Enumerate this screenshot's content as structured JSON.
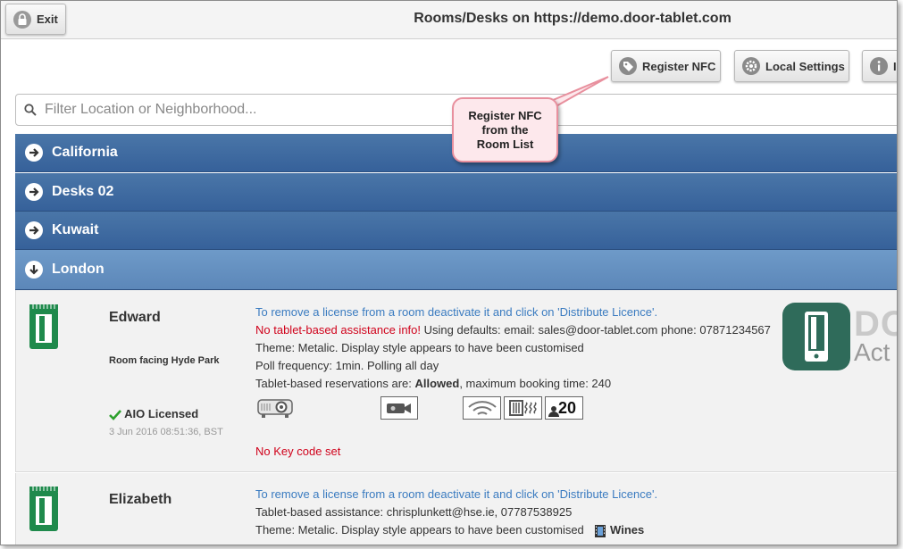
{
  "header": {
    "exit_label": "Exit",
    "title": "Rooms/Desks on https://demo.door-tablet.com"
  },
  "toolbar": {
    "register_nfc_label": "Register NFC",
    "local_settings_label": "Local Settings",
    "info_label": "I"
  },
  "callout": {
    "lines": [
      "Register NFC",
      "from the",
      "Room List"
    ]
  },
  "search": {
    "placeholder": "Filter Location or Neighborhood..."
  },
  "locations": [
    {
      "name": "California",
      "expanded": false
    },
    {
      "name": "Desks 02",
      "expanded": false
    },
    {
      "name": "Kuwait",
      "expanded": false
    },
    {
      "name": "London",
      "expanded": true
    }
  ],
  "rooms": [
    {
      "name": "Edward",
      "description": "Room facing Hyde Park",
      "license_status": "AIO Licensed",
      "license_date": "3 Jun 2016 08:51:36, BST",
      "info_remove": "To remove a license from a room deactivate it and click on 'Distribute Licence'.",
      "assist_warning": "No tablet-based assistance info!",
      "assist_defaults": " Using defaults: email: sales@door-tablet.com phone: 07871234567",
      "theme": "Theme: Metalic. Display style appears to have been customised",
      "poll": "Poll frequency: 1min. Polling all day",
      "reservations_prefix": "Tablet-based reservations are: ",
      "reservations_value": "Allowed",
      "reservations_suffix": ", maximum booking time: 240",
      "capacity": "20",
      "keycode": "No Key code set",
      "logo_text_1": "DOO",
      "logo_text_2": "Act"
    },
    {
      "name": "Elizabeth",
      "info_remove": "To remove a license from a room deactivate it and click on 'Distribute Licence'.",
      "assist": "Tablet-based assistance: chrisplunkett@hse.ie, 07787538925",
      "theme": "Theme: Metalic. Display style appears to have been customised",
      "catering": "Wines"
    }
  ],
  "colors": {
    "bar": "#3e6ba0",
    "bar_active": "#6690c0",
    "link_blue": "#3a7bc0",
    "warning_red": "#d0021b",
    "licensed_green": "#2ca02c",
    "tablet_green": "#1f8a4c"
  }
}
